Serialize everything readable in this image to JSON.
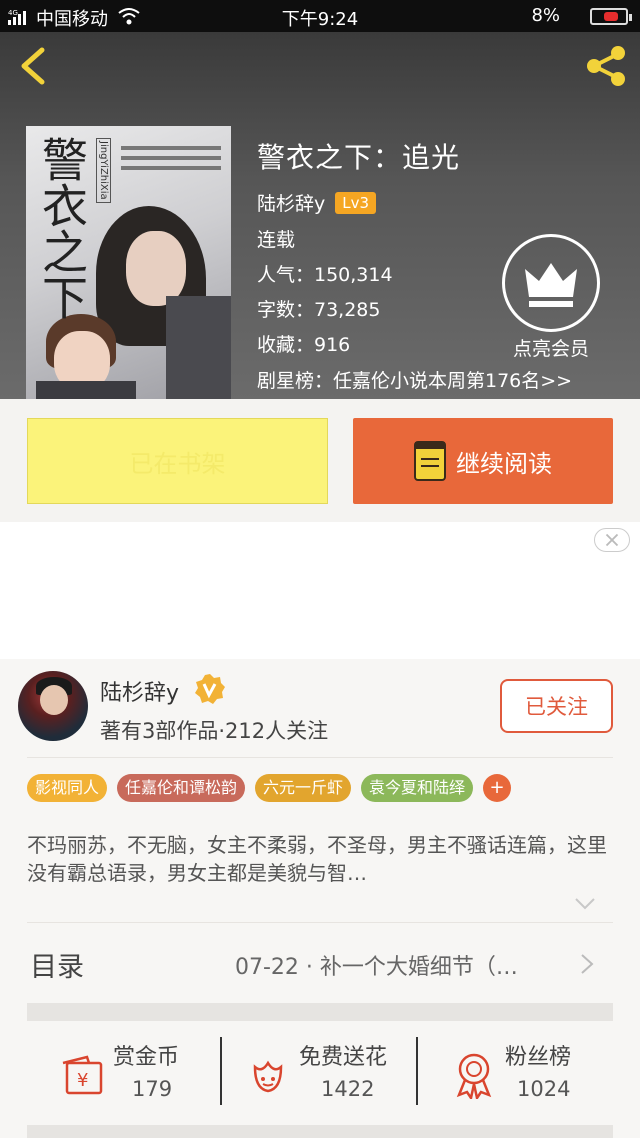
{
  "status_bar": {
    "carrier": "中国移动",
    "signal_label": "4G",
    "time": "下午9:24",
    "battery": "8%"
  },
  "book": {
    "title": "警衣之下：追光",
    "author": "陆杉辞y",
    "level": "Lv3",
    "status": "连载",
    "popularity": "人气：150,314",
    "word_count": "字数：73,285",
    "favorites": "收藏：916",
    "ranking": "剧星榜：任嘉伦小说本周第176名>>",
    "vip_label": "点亮会员",
    "cover": {
      "title": "警衣之下",
      "tag": "JingYiZhiXia"
    }
  },
  "actions": {
    "shelf_label": "已在书架",
    "read_label": "继续阅读"
  },
  "author_card": {
    "name": "陆杉辞y",
    "works": "著有3部作品·212人关注",
    "follow_label": "已关注"
  },
  "tags": [
    {
      "label": "影视同人",
      "color": "#f2b236"
    },
    {
      "label": "任嘉伦和谭松韵",
      "color": "#c86a5b"
    },
    {
      "label": "六元一斤虾",
      "color": "#e2a52e"
    },
    {
      "label": "袁今夏和陆绎",
      "color": "#8cb85a"
    }
  ],
  "tag_more": "+",
  "intro": "不玛丽苏，不无脑，女主不柔弱，不圣母，男主不骚话连篇，这里没有霸总语录，男女主都是美貌与智…",
  "toc": {
    "label": "目录",
    "latest": "07-22 · 补一个大婚细节（…"
  },
  "stats": [
    {
      "label": "赏金币",
      "value": "179",
      "icon": "reward-coin-icon"
    },
    {
      "label": "免费送花",
      "value": "1422",
      "icon": "flower-icon"
    },
    {
      "label": "粉丝榜",
      "value": "1024",
      "icon": "fan-rank-medal-icon"
    }
  ],
  "colors": {
    "accent": "#e8683a",
    "shelf_bg": "#fbf37a",
    "follow": "#e05a3c",
    "level_badge": "#f5a623",
    "back_share": "#f2d23a"
  }
}
